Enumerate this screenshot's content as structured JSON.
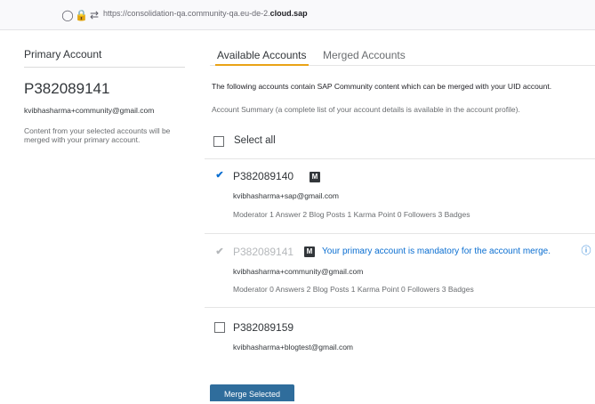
{
  "browser": {
    "url_prefix": "https://consolidation-qa.community-qa.eu-de-2.",
    "url_domain": "cloud.sap"
  },
  "left_panel": {
    "heading": "Primary Account",
    "account_id": "P382089141",
    "email": "kvibhasharma+community@gmail.com",
    "note": "Content from your selected accounts will be merged with your primary account."
  },
  "tabs": [
    {
      "label": "Available Accounts",
      "active": true
    },
    {
      "label": "Merged Accounts",
      "active": false
    }
  ],
  "intro_text": "The following accounts contain SAP Community content which can be merged with your UID account.",
  "summary_text": "Account Summary (a complete list of your account details is available in the account profile).",
  "select_all_label": "Select all",
  "accounts": [
    {
      "id": "P382089140",
      "badge": "M",
      "email": "kvibhasharma+sap@gmail.com",
      "stats": "Moderator  1 Answer  2 Blog Posts  1 Karma Point  0 Followers  3 Badges",
      "checked": true
    },
    {
      "id": "P382089141",
      "badge": "M",
      "message": "Your primary account is mandatory for the account merge.",
      "email": "kvibhasharma+community@gmail.com",
      "stats": "Moderator  0 Answers  2 Blog Posts  1 Karma Point  0 Followers  3 Badges",
      "checked": true,
      "disabled": true
    },
    {
      "id": "P382089159",
      "email": "kvibhasharma+blogtest@gmail.com",
      "checked": false
    }
  ],
  "merge_button_label": "Merge Selected",
  "colors": {
    "accent_tab": "#e9a316",
    "link_blue": "#0a6ed1",
    "button_blue": "#2f6d9c"
  }
}
